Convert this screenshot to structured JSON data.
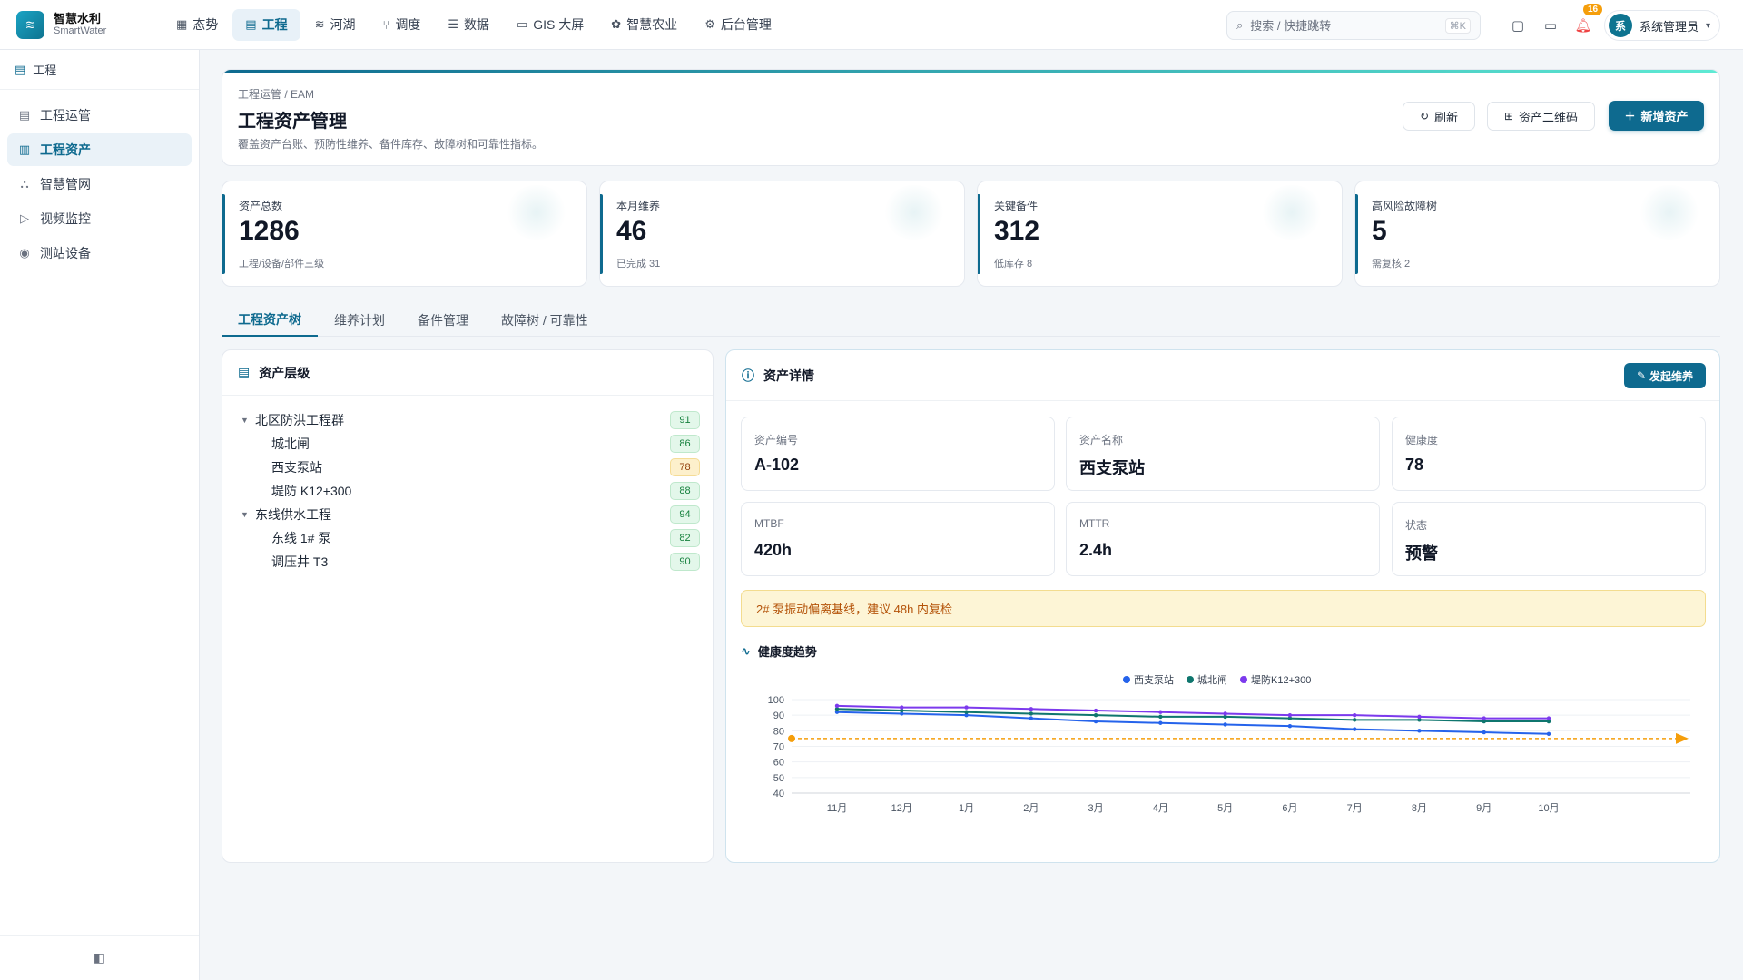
{
  "app": {
    "title": "智慧水利",
    "subtitle": "SmartWater",
    "logo_icon": "waves-icon"
  },
  "nav": [
    {
      "label": "态势",
      "icon": "grid"
    },
    {
      "label": "工程",
      "icon": "building",
      "active": true
    },
    {
      "label": "河湖",
      "icon": "waves"
    },
    {
      "label": "调度",
      "icon": "branch"
    },
    {
      "label": "数据",
      "icon": "database"
    },
    {
      "label": "GIS 大屏",
      "icon": "monitor"
    },
    {
      "label": "智慧农业",
      "icon": "sprout"
    },
    {
      "label": "后台管理",
      "icon": "gear"
    }
  ],
  "search": {
    "placeholder": "搜索 / 快捷跳转",
    "shortcut": "⌘K"
  },
  "notifications": {
    "count": "16"
  },
  "user": {
    "avatar": "系",
    "name": "系统管理员"
  },
  "sidebar": {
    "section": "工程",
    "items": [
      {
        "label": "工程运管"
      },
      {
        "label": "工程资产",
        "active": true
      },
      {
        "label": "智慧管网"
      },
      {
        "label": "视频监控"
      },
      {
        "label": "测站设备"
      }
    ]
  },
  "header": {
    "breadcrumb": "工程运管 / EAM",
    "title": "工程资产管理",
    "description": "覆盖资产台账、预防性维养、备件库存、故障树和可靠性指标。",
    "refresh_label": "刷新",
    "qrcode_label": "资产二维码",
    "add_label": "新增资产"
  },
  "stats": [
    {
      "label": "资产总数",
      "value": "1286",
      "sub": "工程/设备/部件三级"
    },
    {
      "label": "本月维养",
      "value": "46",
      "sub": "已完成 31"
    },
    {
      "label": "关键备件",
      "value": "312",
      "sub": "低库存 8"
    },
    {
      "label": "高风险故障树",
      "value": "5",
      "sub": "需复核 2"
    }
  ],
  "tabs": [
    {
      "label": "工程资产树",
      "active": true
    },
    {
      "label": "维养计划"
    },
    {
      "label": "备件管理"
    },
    {
      "label": "故障树 / 可靠性"
    }
  ],
  "tree": {
    "title": "资产层级",
    "nodes": [
      {
        "label": "北区防洪工程群",
        "score": "91",
        "level": 0
      },
      {
        "label": "城北闸",
        "score": "86",
        "level": 1
      },
      {
        "label": "西支泵站",
        "score": "78",
        "level": 1
      },
      {
        "label": "堤防 K12+300",
        "score": "88",
        "level": 1
      },
      {
        "label": "东线供水工程",
        "score": "94",
        "level": 0
      },
      {
        "label": "东线 1# 泵",
        "score": "82",
        "level": 1
      },
      {
        "label": "调压井 T3",
        "score": "90",
        "level": 1
      }
    ]
  },
  "detail": {
    "title": "资产详情",
    "maintain_label": "发起维养",
    "fields": [
      {
        "label": "资产编号",
        "value": "A-102"
      },
      {
        "label": "资产名称",
        "value": "西支泵站"
      },
      {
        "label": "健康度",
        "value": "78"
      },
      {
        "label": "MTBF",
        "value": "420h"
      },
      {
        "label": "MTTR",
        "value": "2.4h"
      },
      {
        "label": "状态",
        "value": "预警"
      }
    ],
    "alert": "2# 泵振动偏离基线，建议 48h 内复检",
    "trend_title": "健康度趋势"
  },
  "chart_data": {
    "type": "line",
    "categories": [
      "11月",
      "12月",
      "1月",
      "2月",
      "3月",
      "4月",
      "5月",
      "6月",
      "7月",
      "8月",
      "9月",
      "10月"
    ],
    "ylim": [
      40,
      100
    ],
    "yticks": [
      40,
      50,
      60,
      70,
      80,
      90,
      100
    ],
    "grid": true,
    "legend_position": "top",
    "threshold": 75,
    "series": [
      {
        "name": "西支泵站",
        "color": "#2563eb",
        "values": [
          92,
          91,
          90,
          88,
          86,
          85,
          84,
          83,
          81,
          80,
          79,
          78
        ]
      },
      {
        "name": "城北闸",
        "color": "#0f766e",
        "values": [
          94,
          93,
          92,
          91,
          90,
          89,
          89,
          88,
          87,
          87,
          86,
          86
        ]
      },
      {
        "name": "堤防K12+300",
        "color": "#7c3aed",
        "values": [
          96,
          95,
          95,
          94,
          93,
          92,
          91,
          90,
          90,
          89,
          88,
          88
        ]
      }
    ],
    "threshold_color": "#f59e0b"
  }
}
